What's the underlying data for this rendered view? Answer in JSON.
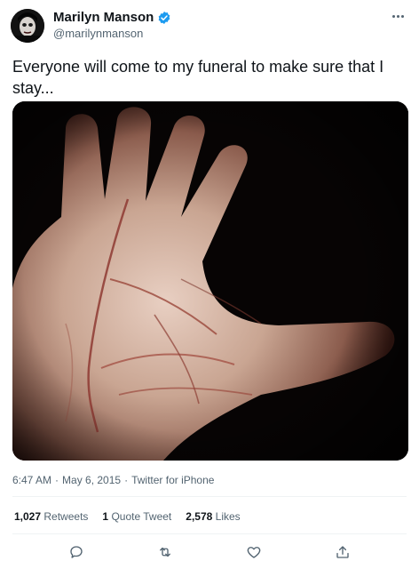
{
  "author": {
    "display_name": "Marilyn Manson",
    "handle": "@marilynmanson",
    "verified": true
  },
  "tweet": {
    "text": "Everyone will come to my funeral to make sure that I stay...",
    "time": "6:47 AM",
    "date": "May 6, 2015",
    "source": "Twitter for iPhone",
    "separator": "·"
  },
  "stats": {
    "retweets_count": "1,027",
    "retweets_label": "Retweets",
    "quotes_count": "1",
    "quotes_label": "Quote Tweet",
    "likes_count": "2,578",
    "likes_label": "Likes"
  },
  "icons": {
    "more": "more-icon",
    "verified": "verified-badge-icon",
    "reply": "reply-icon",
    "retweet": "retweet-icon",
    "like": "heart-icon",
    "share": "share-icon"
  },
  "colors": {
    "verified": "#1d9bf0",
    "text": "#0f1419",
    "secondary": "#536471",
    "divider": "#eff3f4"
  }
}
